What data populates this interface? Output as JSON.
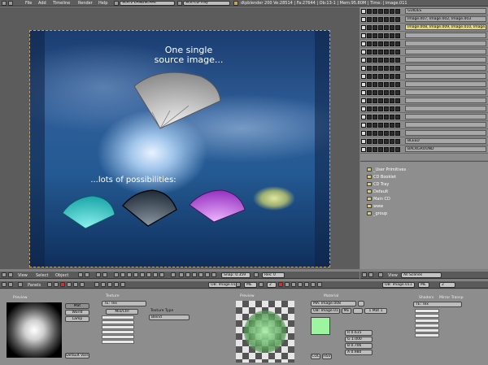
{
  "top_menu": [
    "File",
    "Add",
    "Timeline",
    "Render",
    "Help"
  ],
  "screen_selector": "SCR:2 LANDSCAPE",
  "scene_selector": "SCE:CD Tray",
  "status": "dtpblender 200  Ve:28514 | Fa:27644 | Ob:13-1 | Mem:95.80M | Time: | image.011",
  "canvas": {
    "text1": "One single",
    "text2": "source image...",
    "text3": "...lots of possibilities:"
  },
  "outliner": {
    "rows": [
      "GUIDES",
      "Image.007, Image.002, Image.003",
      "Image.008, Image.009, Image.010, Image.0",
      "",
      "",
      "",
      "",
      "",
      "",
      "",
      "",
      "",
      "",
      "",
      "",
      "",
      "BLEED",
      "BACKGROUND"
    ]
  },
  "scenes": {
    "items": [
      "_User Primitives",
      "CD Booklet",
      "CD Tray",
      "Default",
      "Main CD",
      "www",
      "_group"
    ]
  },
  "view_header": {
    "view": "View",
    "select": "Select",
    "object": "Object",
    "snap": "Snap: 0.359",
    "res": "Res: 0"
  },
  "outliner_header": {
    "view": "View",
    "filter": "All Scenes"
  },
  "buttons_header": {
    "panels": "Panels",
    "object": "OB: Image.011",
    "me": "ME",
    "frame": "2"
  },
  "shading": {
    "preview_title": "Preview",
    "mat": "Mat",
    "world": "World",
    "lamp": "Lamp",
    "default_vars": "Default Vars",
    "texture_title": "Texture",
    "tex_name": "TE: Tex",
    "tex_type_label": "Texture Type",
    "tex_type": "Blend",
    "mix_label": "Mix/Ctrl",
    "mat_preview_title": "Preview",
    "material_title": "Material",
    "mat_name": "MA: Image.008",
    "ob_name": "OB: Image.011",
    "me": "ME",
    "mat_index": "1 Mat 1",
    "rgb": [
      "R 0.615",
      "G 1.000",
      "B 0.706",
      "A 0.980"
    ],
    "shaders_title": "Shaders",
    "mirror_title": "Mirror Transp",
    "col_btn": "COL",
    "hsv_btn": "HSV",
    "ma_tex": "TE: Tex"
  },
  "colors": {
    "swatch": "#9ef5a0",
    "header": "#5a5a5a"
  }
}
